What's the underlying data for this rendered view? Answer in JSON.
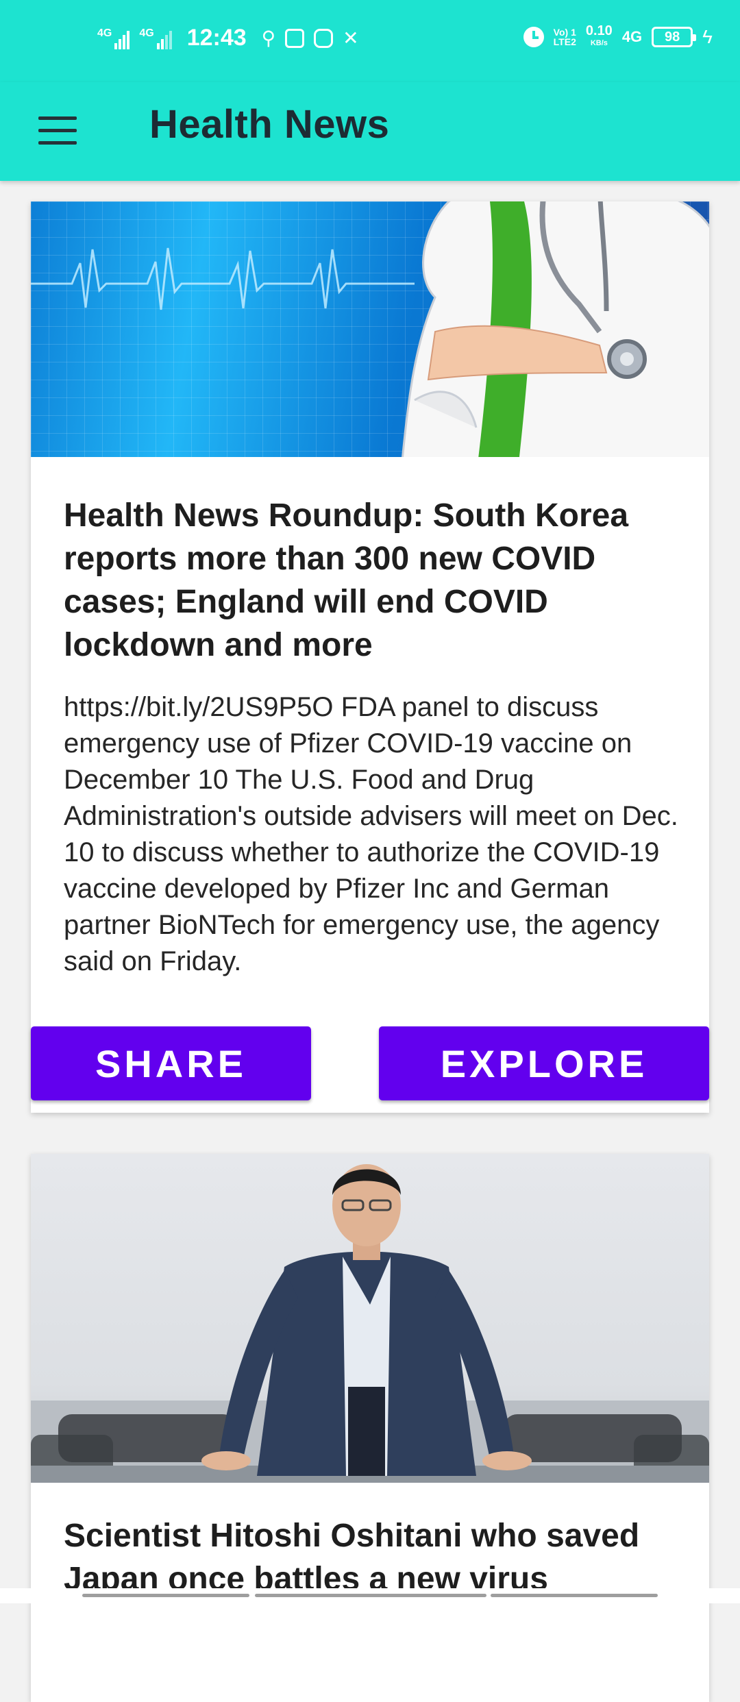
{
  "status_bar": {
    "signal1": "4G",
    "signal2": "4G",
    "time": "12:43",
    "volte": "Vo) 1",
    "lte": "LTE2",
    "speed": "0.10",
    "speed_unit": "KB/s",
    "net_type": "4G",
    "battery": "98"
  },
  "app_bar": {
    "title": "Health News",
    "menu_icon": "hamburger-menu-icon"
  },
  "articles": [
    {
      "image": "doctor-with-stethoscope-and-ecg-illustration",
      "title": "Health News Roundup: South Korea reports more than 300 new COVID cases; England will end COVID lockdown and more",
      "body": "https://bit.ly/2US9P5O FDA panel to discuss emergency use of Pfizer COVID-19 vaccine on December 10 The U.S. Food and Drug Administration's outside advisers will meet on Dec. 10 to discuss whether to authorize the COVID-19 vaccine developed by Pfizer Inc and German partner BioNTech for emergency use, the agency said on Friday.",
      "share_label": "SHARE",
      "explore_label": "EXPLORE"
    },
    {
      "image": "photo-of-man-in-suit-at-table",
      "title": "Scientist Hitoshi Oshitani who saved Japan once battles a new virus"
    }
  ],
  "colors": {
    "primary": "#1de3d0",
    "button": "#6200ee",
    "title_text": "#1d2b33"
  }
}
